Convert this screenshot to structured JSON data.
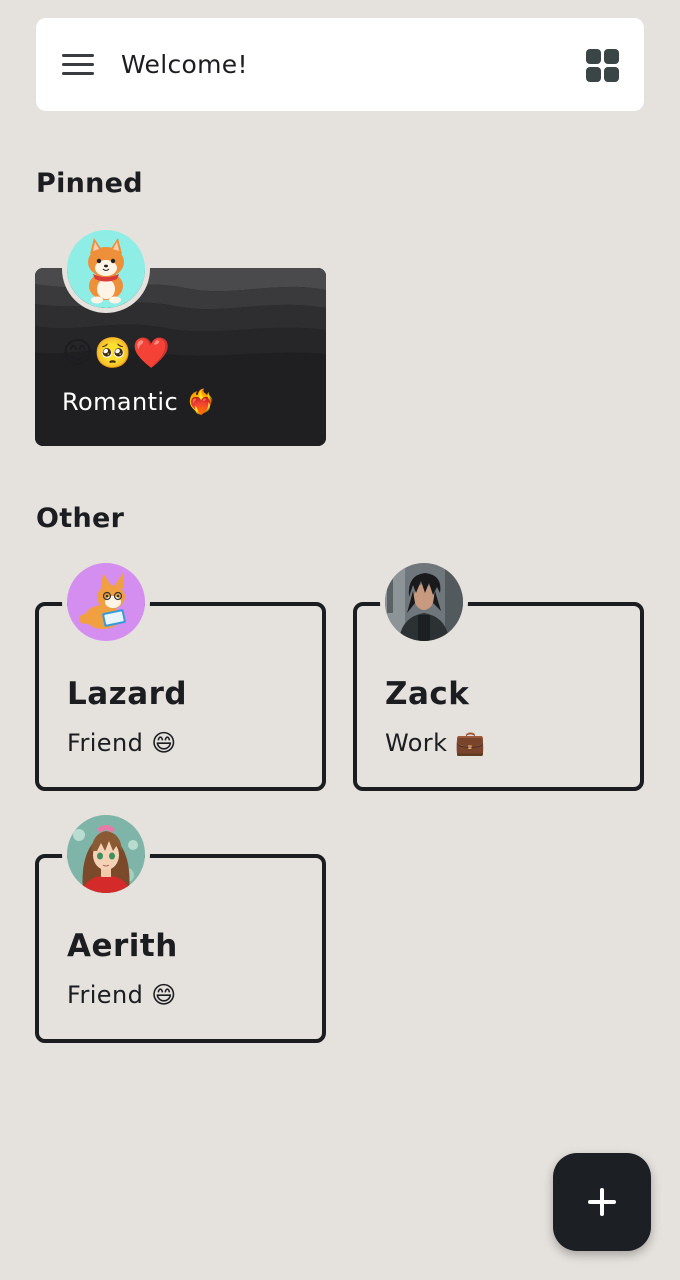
{
  "header": {
    "title": "Welcome!",
    "menu_icon": "hamburger-menu-icon",
    "layout_icon": "grid-view-icon"
  },
  "sections": {
    "pinned_title": "Pinned",
    "other_title": "Other"
  },
  "pinned_cards": [
    {
      "avatar": "shiba-dog-avatar",
      "emojis": "😊🥺❤️",
      "label": "Romantic ❤️‍🔥"
    }
  ],
  "other_cards": [
    {
      "name": "Lazard",
      "tag": "Friend 😄",
      "avatar": "corgi-reading-avatar"
    },
    {
      "name": "Zack",
      "tag": "Work 💼",
      "avatar": "dark-haired-warrior-avatar"
    },
    {
      "name": "Aerith",
      "tag": "Friend 😄",
      "avatar": "anime-girl-avatar"
    }
  ],
  "fab": {
    "icon": "plus-icon"
  },
  "colors": {
    "background": "#e5e1dd",
    "card_border": "#1c1d21",
    "pinned_card_bg": "#1e1e20",
    "fab_bg": "#1c2024"
  }
}
